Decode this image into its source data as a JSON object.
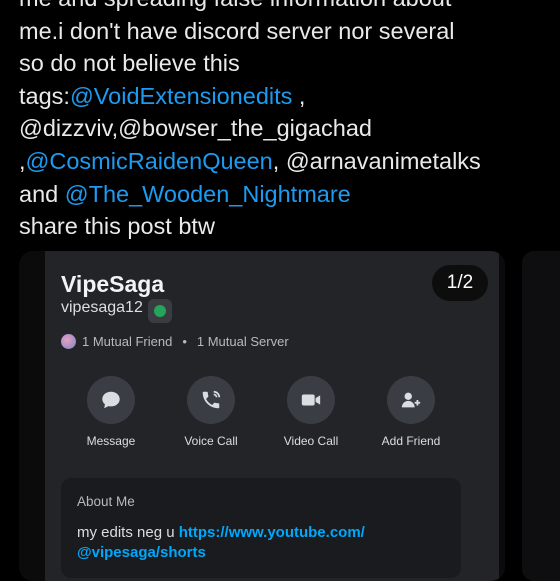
{
  "post": {
    "line0_text": "me and spreading false information about",
    "line1_text": "me.i don't have discord server nor several",
    "line2_text": "so do not believe this",
    "line3_prefix": "tags:",
    "line3_mention": "@VoidExtensionedits",
    "line3_suffix": " ,",
    "line4_text": "@dizzviv,@bowser_the_gigachad",
    "line5_prefix": ",",
    "line5_mention": "@CosmicRaidenQueen",
    "line5_suffix": ", @arnavanimetalks",
    "line6_prefix": "and ",
    "line6_mention": "@The_Wooden_Nightmare",
    "line7_text": "share this post btw"
  },
  "media": {
    "pager": "1/2"
  },
  "profile": {
    "display_name": "VipeSaga",
    "username": "vipesaga12",
    "mutual_friend": "1 Mutual Friend",
    "separator": "•",
    "mutual_server": "1 Mutual Server",
    "actions": [
      {
        "label": "Message",
        "icon": "chat-bubble-icon"
      },
      {
        "label": "Voice Call",
        "icon": "phone-icon"
      },
      {
        "label": "Video Call",
        "icon": "video-camera-icon"
      },
      {
        "label": "Add Friend",
        "icon": "add-friend-icon"
      }
    ],
    "about_title": "About Me",
    "bio_prefix": "my edits neg u ",
    "bio_link_line1": "https://www.youtube.com/",
    "bio_link_line2": "@vipesaga/shorts"
  },
  "colors": {
    "background": "#000000",
    "mention": "#1d9bf0",
    "discord_link": "#00a8fc",
    "status_online": "#23a55a"
  }
}
